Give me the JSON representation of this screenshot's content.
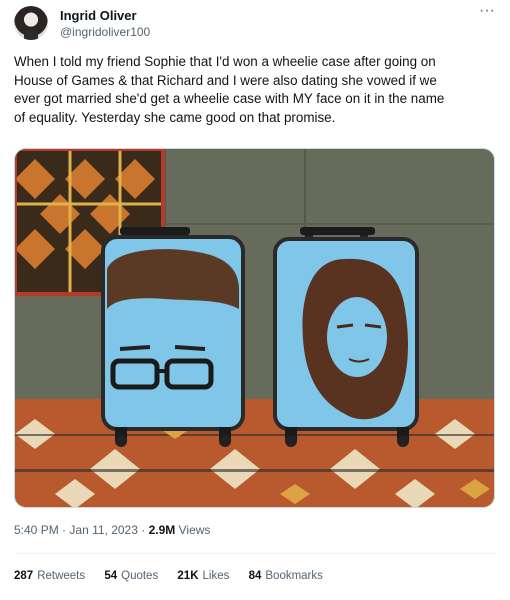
{
  "author": {
    "display_name": "Ingrid Oliver",
    "handle": "@ingridoliver100",
    "avatar_icon": "user-avatar"
  },
  "menu": {
    "more_icon": "more-horizontal-icon",
    "more_glyph": "···"
  },
  "tweet": {
    "text_lines": [
      "When I told my friend Sophie that I'd won a wheelie case after going on",
      "House of Games & that Richard and I were also dating she vowed if we",
      "ever got married she'd get a wheelie case with MY face on it in the name",
      "of equality. Yesterday she came good on that promise."
    ]
  },
  "media": {
    "description_icon": "photo-two-suitcases"
  },
  "meta": {
    "time": "5:40 PM",
    "separator": "·",
    "date": "Jan 11, 2023",
    "views_count": "2.9M",
    "views_label": "Views"
  },
  "stats": {
    "retweets_count": "287",
    "retweets_label": "Retweets",
    "quotes_count": "54",
    "quotes_label": "Quotes",
    "likes_count": "21K",
    "likes_label": "Likes",
    "bookmarks_count": "84",
    "bookmarks_label": "Bookmarks"
  },
  "colors": {
    "text": "#0f1419",
    "secondary": "#536471",
    "suitcase_blue": "#7fc6e8",
    "border": "#cfd9de"
  }
}
